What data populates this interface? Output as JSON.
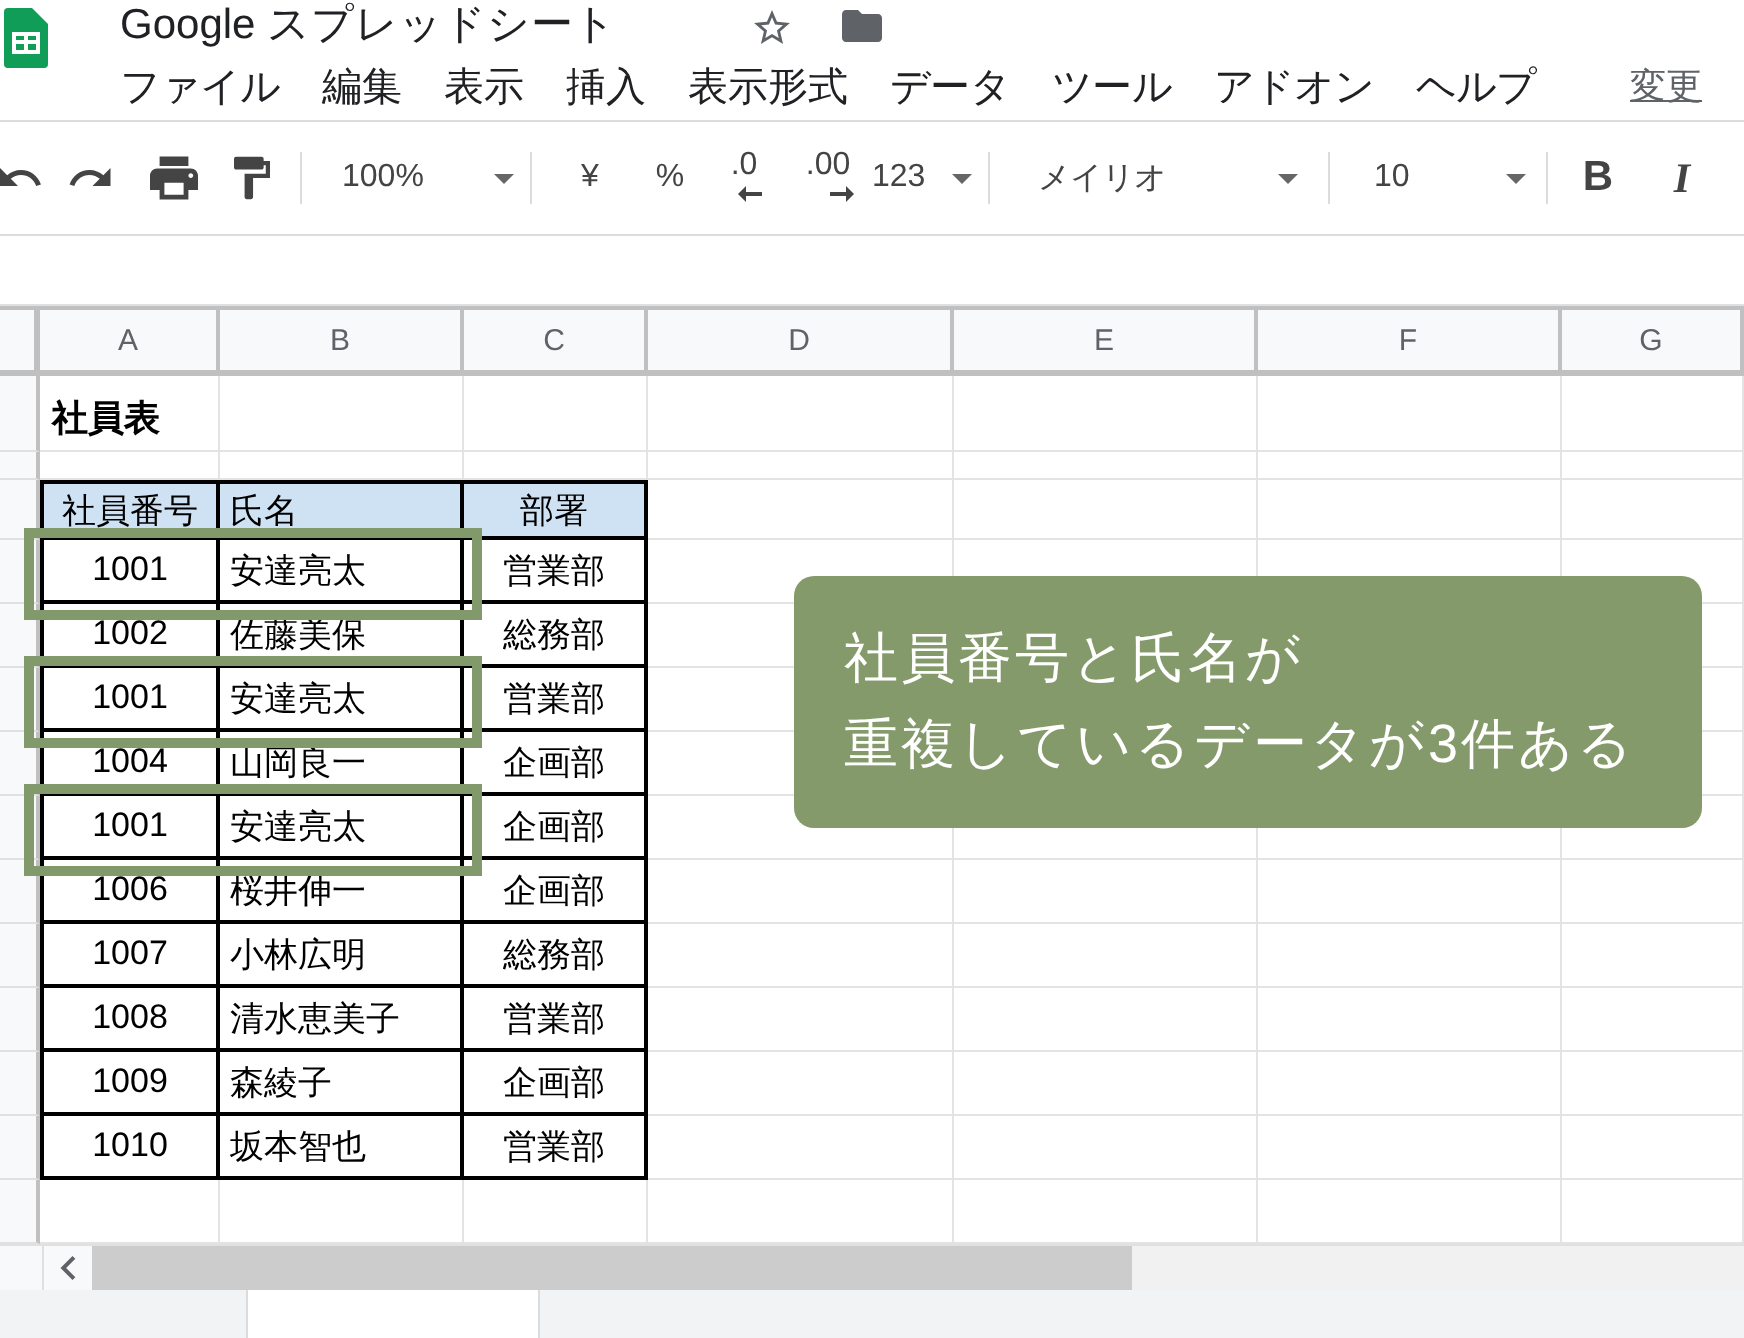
{
  "app": {
    "title": "Google スプレッドシート",
    "save_status": "変更"
  },
  "menu": [
    "ファイル",
    "編集",
    "表示",
    "挿入",
    "表示形式",
    "データ",
    "ツール",
    "アドオン",
    "ヘルプ"
  ],
  "toolbar": {
    "zoom": "100%",
    "currency": "¥",
    "percent": "%",
    "decrease_decimal": ".0",
    "increase_decimal": ".00",
    "number_format": "123",
    "font": "メイリオ",
    "font_size": "10",
    "bold": "B",
    "italic": "I"
  },
  "sheet": {
    "columns": [
      "A",
      "B",
      "C",
      "D",
      "E",
      "F",
      "G"
    ],
    "title": "社員表",
    "table": {
      "columns": [
        "社員番号",
        "氏名",
        "部署"
      ],
      "rows": [
        {
          "cells": [
            "1001",
            "安達亮太",
            "営業部"
          ],
          "highlighted": true
        },
        {
          "cells": [
            "1002",
            "佐藤美保",
            "総務部"
          ],
          "highlighted": false
        },
        {
          "cells": [
            "1001",
            "安達亮太",
            "営業部"
          ],
          "highlighted": true
        },
        {
          "cells": [
            "1004",
            "山岡良一",
            "企画部"
          ],
          "highlighted": false
        },
        {
          "cells": [
            "1001",
            "安達亮太",
            "企画部"
          ],
          "highlighted": true
        },
        {
          "cells": [
            "1006",
            "桜井伸一",
            "企画部"
          ],
          "highlighted": false
        },
        {
          "cells": [
            "1007",
            "小林広明",
            "総務部"
          ],
          "highlighted": false
        },
        {
          "cells": [
            "1008",
            "清水恵美子",
            "営業部"
          ],
          "highlighted": false
        },
        {
          "cells": [
            "1009",
            "森綾子",
            "企画部"
          ],
          "highlighted": false
        },
        {
          "cells": [
            "1010",
            "坂本智也",
            "営業部"
          ],
          "highlighted": false
        }
      ]
    }
  },
  "callout": {
    "lines": [
      "社員番号と氏名が",
      "重複しているデータが3件ある"
    ]
  }
}
